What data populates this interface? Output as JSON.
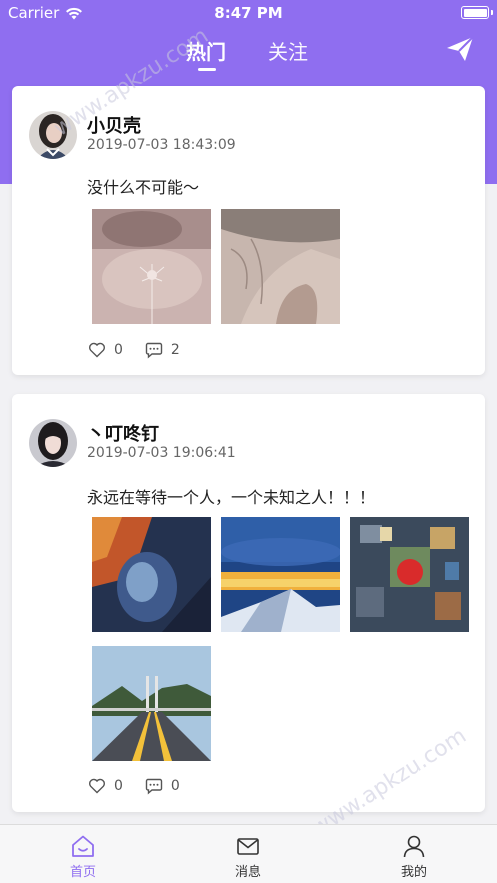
{
  "status_bar": {
    "carrier": "Carrier",
    "time": "8:47 PM"
  },
  "top_nav": {
    "tabs": [
      "热门",
      "关注"
    ],
    "active_tab": "热门"
  },
  "colors": {
    "accent": "#8f6ef0"
  },
  "posts": [
    {
      "username": "小贝壳",
      "timestamp": "2019-07-03 18:43:09",
      "text": "没什么不可能～",
      "likes": "0",
      "comments": "2"
    },
    {
      "username": "丶叮咚钉",
      "timestamp": "2019-07-03 19:06:41",
      "text": "永远在等待一个人，一个未知之人！！！",
      "likes": "0",
      "comments": "0"
    }
  ],
  "tabbar": {
    "home": "首页",
    "messages": "消息",
    "me": "我的"
  },
  "watermark": "www.apkzu.com"
}
